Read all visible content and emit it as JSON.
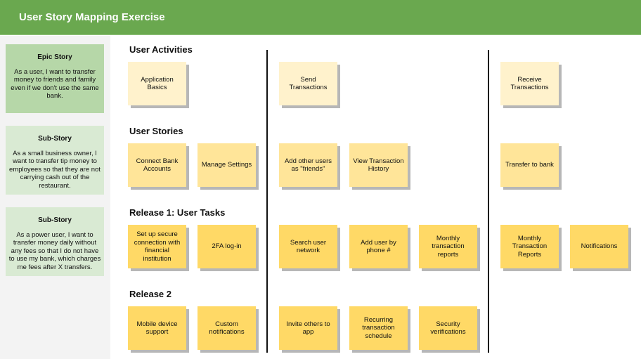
{
  "header": {
    "title": "User Story Mapping Exercise"
  },
  "colors": {
    "header": "#6aa84f",
    "epic": "#b6d7a8",
    "sub_story": "#d9ead3",
    "activity_note": "#fff2cc",
    "story_note": "#ffe599",
    "task_note": "#ffd966"
  },
  "sidebar": {
    "stories": [
      {
        "title": "Epic Story",
        "body": "As a user, I want to transfer money to friends and family even if we don't use the same bank."
      },
      {
        "title": "Sub-Story",
        "body": "As a small business owner, I want to transfer tip money to employees so that they are not carrying cash out of the restaurant."
      },
      {
        "title": "Sub-Story",
        "body": "As a power user, I want to transfer money daily without any fees so that I do not have to use my bank, which charges me fees after X transfers."
      }
    ]
  },
  "rows": {
    "activities": "User Activities",
    "stories": "User Stories",
    "release1": "Release 1: User Tasks",
    "release2": "Release 2"
  },
  "notes": {
    "activities": [
      "Application Basics",
      "Send Transactions",
      "Receive Transactions"
    ],
    "stories": [
      "Connect Bank Accounts",
      "Manage Settings",
      "Add other users as \"friends\"",
      "View Transaction History",
      "Transfer to bank"
    ],
    "release1": [
      "Set up secure connection with financial institution",
      "2FA log-in",
      "Search user network",
      "Add user by phone #",
      "Monthly transaction reports",
      "Monthly Transaction Reports",
      "Notifications"
    ],
    "release2": [
      "Mobile device support",
      "Custom notifications",
      "Invite others to app",
      "Recurring transaction schedule",
      "Security verifications"
    ]
  }
}
